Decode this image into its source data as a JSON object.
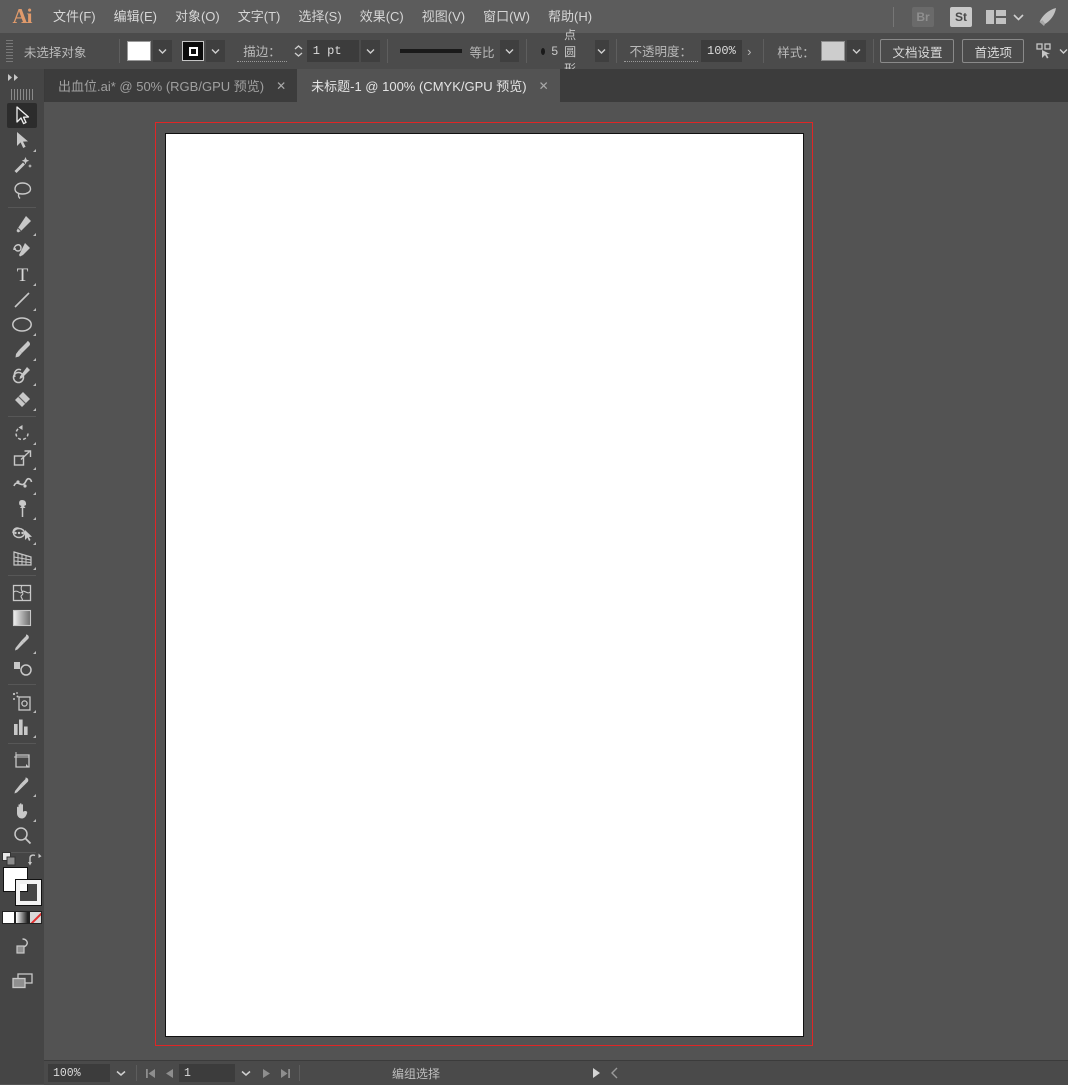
{
  "app": {
    "name": "Adobe Illustrator",
    "logo_text": "Ai",
    "accent_color": "#e09a6b",
    "bleed_guide_color": "#e02626"
  },
  "menubar": {
    "items": [
      {
        "label": "文件(F)",
        "accel": "F"
      },
      {
        "label": "编辑(E)",
        "accel": "E"
      },
      {
        "label": "对象(O)",
        "accel": "O"
      },
      {
        "label": "文字(T)",
        "accel": "T"
      },
      {
        "label": "选择(S)",
        "accel": "S"
      },
      {
        "label": "效果(C)",
        "accel": "C"
      },
      {
        "label": "视图(V)",
        "accel": "V"
      },
      {
        "label": "窗口(W)",
        "accel": "W"
      },
      {
        "label": "帮助(H)",
        "accel": "H"
      }
    ],
    "right": {
      "bridge_label": "Br",
      "stock_label": "St",
      "arrange_icon": "arrange-documents-icon",
      "chevron_icon": "chevron-down-icon",
      "rocket_icon": "rocket-icon"
    }
  },
  "controlbar": {
    "selection_label": "未选择对象",
    "fill_swatch_color": "#ffffff",
    "stroke_swatch_color": "#0c0c0c",
    "stroke_label": "描边：",
    "stroke_width": "1 pt",
    "stroke_profile_label": "等比",
    "brush_size": "5",
    "brush_label": "点圆形",
    "opacity_label": "不透明度：",
    "opacity_value": "100%",
    "opacity_more": "›",
    "style_label": "样式：",
    "style_swatch_color": "#cdcdcd",
    "doc_setup_label": "文档设置",
    "preferences_label": "首选项",
    "select_similar_icon": "select-similar-icon"
  },
  "tabs": [
    {
      "title": "出血位.ai* @ 50% (RGB/GPU 预览)",
      "active": false,
      "close": "✕"
    },
    {
      "title": "未标题-1 @ 100% (CMYK/GPU 预览)",
      "active": true,
      "close": "✕"
    }
  ],
  "toolbar": {
    "collapse_icon": "double-chevron-right-icon",
    "groups": [
      [
        {
          "name": "selection-tool",
          "selected": true,
          "has_flyout": false
        },
        {
          "name": "direct-selection-tool",
          "selected": false,
          "has_flyout": true
        },
        {
          "name": "magic-wand-tool",
          "selected": false,
          "has_flyout": false
        },
        {
          "name": "lasso-tool",
          "selected": false,
          "has_flyout": false
        }
      ],
      [
        {
          "name": "pen-tool",
          "selected": false,
          "has_flyout": true
        },
        {
          "name": "curvature-tool",
          "selected": false,
          "has_flyout": false
        },
        {
          "name": "type-tool",
          "selected": false,
          "has_flyout": true
        },
        {
          "name": "line-segment-tool",
          "selected": false,
          "has_flyout": true
        },
        {
          "name": "ellipse-tool",
          "selected": false,
          "has_flyout": true
        },
        {
          "name": "paintbrush-tool",
          "selected": false,
          "has_flyout": true
        },
        {
          "name": "shaper-tool",
          "selected": false,
          "has_flyout": true
        },
        {
          "name": "eraser-tool",
          "selected": false,
          "has_flyout": true
        }
      ],
      [
        {
          "name": "rotate-tool",
          "selected": false,
          "has_flyout": true
        },
        {
          "name": "scale-tool",
          "selected": false,
          "has_flyout": true
        },
        {
          "name": "width-tool",
          "selected": false,
          "has_flyout": true
        },
        {
          "name": "free-transform-tool",
          "selected": false,
          "has_flyout": true
        },
        {
          "name": "shape-builder-tool",
          "selected": false,
          "has_flyout": true
        },
        {
          "name": "perspective-grid-tool",
          "selected": false,
          "has_flyout": true
        }
      ],
      [
        {
          "name": "mesh-tool",
          "selected": false,
          "has_flyout": false
        },
        {
          "name": "gradient-tool",
          "selected": false,
          "has_flyout": false
        },
        {
          "name": "eyedropper-tool",
          "selected": false,
          "has_flyout": true
        },
        {
          "name": "blend-tool",
          "selected": false,
          "has_flyout": false
        }
      ],
      [
        {
          "name": "symbol-sprayer-tool",
          "selected": false,
          "has_flyout": true
        },
        {
          "name": "column-graph-tool",
          "selected": false,
          "has_flyout": true
        }
      ],
      [
        {
          "name": "artboard-tool",
          "selected": false,
          "has_flyout": false
        },
        {
          "name": "slice-tool",
          "selected": false,
          "has_flyout": true
        },
        {
          "name": "hand-tool",
          "selected": false,
          "has_flyout": true
        },
        {
          "name": "zoom-tool",
          "selected": false,
          "has_flyout": false
        }
      ]
    ],
    "color_widget": {
      "fill_color": "#ffffff",
      "stroke_color": "#ffffff",
      "swap_icon": "swap-fill-stroke-icon",
      "default_icon": "default-fill-stroke-icon",
      "modes": [
        "color-mode",
        "gradient-mode",
        "none-mode"
      ]
    },
    "draw_mode_icon": "draw-normal-icon",
    "screen_mode_icon": "screen-mode-icon"
  },
  "statusbar": {
    "zoom_value": "100%",
    "zoom_dropdown_icon": "chevron-down-icon",
    "first_artboard_icon": "first-artboard-icon",
    "prev_artboard_icon": "prev-artboard-icon",
    "artboard_number": "1",
    "artboard_dropdown_icon": "chevron-down-icon",
    "next_artboard_icon": "next-artboard-icon",
    "last_artboard_icon": "last-artboard-icon",
    "status_text": "编组选择",
    "play_icon": "status-menu-icon",
    "resize_grip_icon": "chevron-left-icon"
  },
  "canvas": {
    "bleed_guide": "bleed-guide",
    "artboard_fill": "#ffffff"
  }
}
